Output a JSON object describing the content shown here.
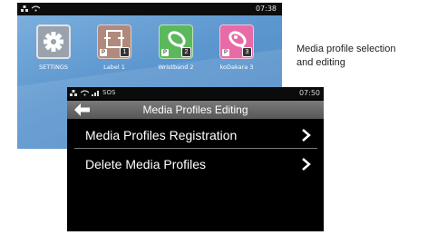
{
  "back_screen": {
    "time": "07:38",
    "tiles": [
      {
        "label": "SETTINGS",
        "icon": "gear-icon"
      },
      {
        "label": "Label 1",
        "icon": "label-icon",
        "badge": "1"
      },
      {
        "label": "Wristband 2",
        "icon": "wristband-icon",
        "badge": "2"
      },
      {
        "label": "koDakara 3",
        "icon": "kodakara-icon",
        "badge": "3"
      }
    ]
  },
  "front_screen": {
    "status": {
      "sos": "SOS",
      "time": "07:50"
    },
    "title": "Media Profiles Editing",
    "menu": [
      {
        "label": "Media Profiles Registration"
      },
      {
        "label": "Delete Media Profiles"
      }
    ]
  },
  "caption": {
    "line1": "Media profile selection",
    "line2": "and editing"
  },
  "colors": {
    "home_background": "#5d97cf",
    "title_bar": "#6a6a6a",
    "settings_tile": "#9aa3ad",
    "label_tile": "#b08a7d",
    "wristband_tile": "#5bb85c",
    "kodakara_tile": "#e86aa6"
  }
}
